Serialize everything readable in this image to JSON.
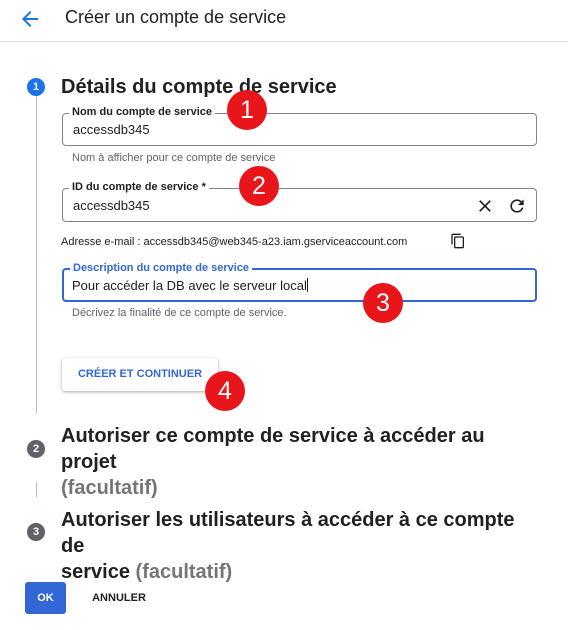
{
  "header": {
    "title": "Créer un compte de service"
  },
  "steps": [
    {
      "number": "1",
      "title": "Détails du compte de service"
    },
    {
      "number": "2",
      "title": "Autoriser ce compte de service à accéder au projet",
      "optional": "(facultatif)"
    },
    {
      "number": "3",
      "title_line1": "Autoriser les utilisateurs à accéder à ce compte de",
      "title_line2": "service",
      "optional": "(facultatif)"
    }
  ],
  "form": {
    "name": {
      "label": "Nom du compte de service",
      "value": "accessdb345",
      "hint": "Nom à afficher pour ce compte de service"
    },
    "id": {
      "label": "ID du compte de service *",
      "value": "accessdb345"
    },
    "email": {
      "text": "Adresse e-mail : accessdb345@web345-a23.iam.gserviceaccount.com"
    },
    "description": {
      "label": "Description du compte de service",
      "value": "Pour accéder la DB avec le serveur local",
      "hint": "Décrivez la finalité de ce compte de service."
    }
  },
  "buttons": {
    "create": "CRÉER ET CONTINUER",
    "ok": "OK",
    "cancel": "ANNULER"
  },
  "annotations": [
    "1",
    "2",
    "3",
    "4"
  ],
  "icons": {
    "back": "arrow-back-icon",
    "clear": "close-icon",
    "refresh": "refresh-icon",
    "copy": "copy-icon"
  },
  "colors": {
    "accent": "#3367d6",
    "annotation": "#e8161a"
  }
}
